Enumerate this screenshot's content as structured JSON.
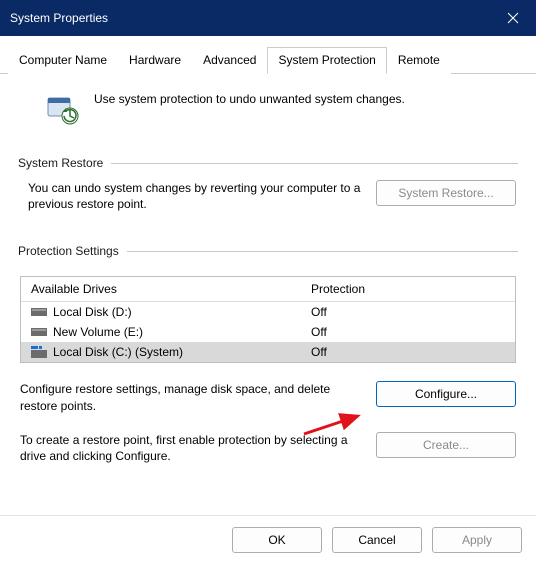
{
  "titlebar": {
    "title": "System Properties"
  },
  "tabs": [
    "Computer Name",
    "Hardware",
    "Advanced",
    "System Protection",
    "Remote"
  ],
  "active_tab_index": 3,
  "intro_text": "Use system protection to undo unwanted system changes.",
  "system_restore": {
    "legend": "System Restore",
    "desc": "You can undo system changes by reverting your computer to a previous restore point.",
    "button": "System Restore..."
  },
  "protection_settings": {
    "legend": "Protection Settings",
    "columns": [
      "Available Drives",
      "Protection"
    ],
    "drives": [
      {
        "name": "Local Disk (D:)",
        "protection": "Off",
        "selected": false,
        "system": false
      },
      {
        "name": "New Volume (E:)",
        "protection": "Off",
        "selected": false,
        "system": false
      },
      {
        "name": "Local Disk (C:) (System)",
        "protection": "Off",
        "selected": true,
        "system": true
      }
    ],
    "configure_desc": "Configure restore settings, manage disk space, and delete restore points.",
    "configure_button": "Configure...",
    "create_desc": "To create a restore point, first enable protection by selecting a drive and clicking Configure.",
    "create_button": "Create..."
  },
  "footer": {
    "ok": "OK",
    "cancel": "Cancel",
    "apply": "Apply"
  }
}
